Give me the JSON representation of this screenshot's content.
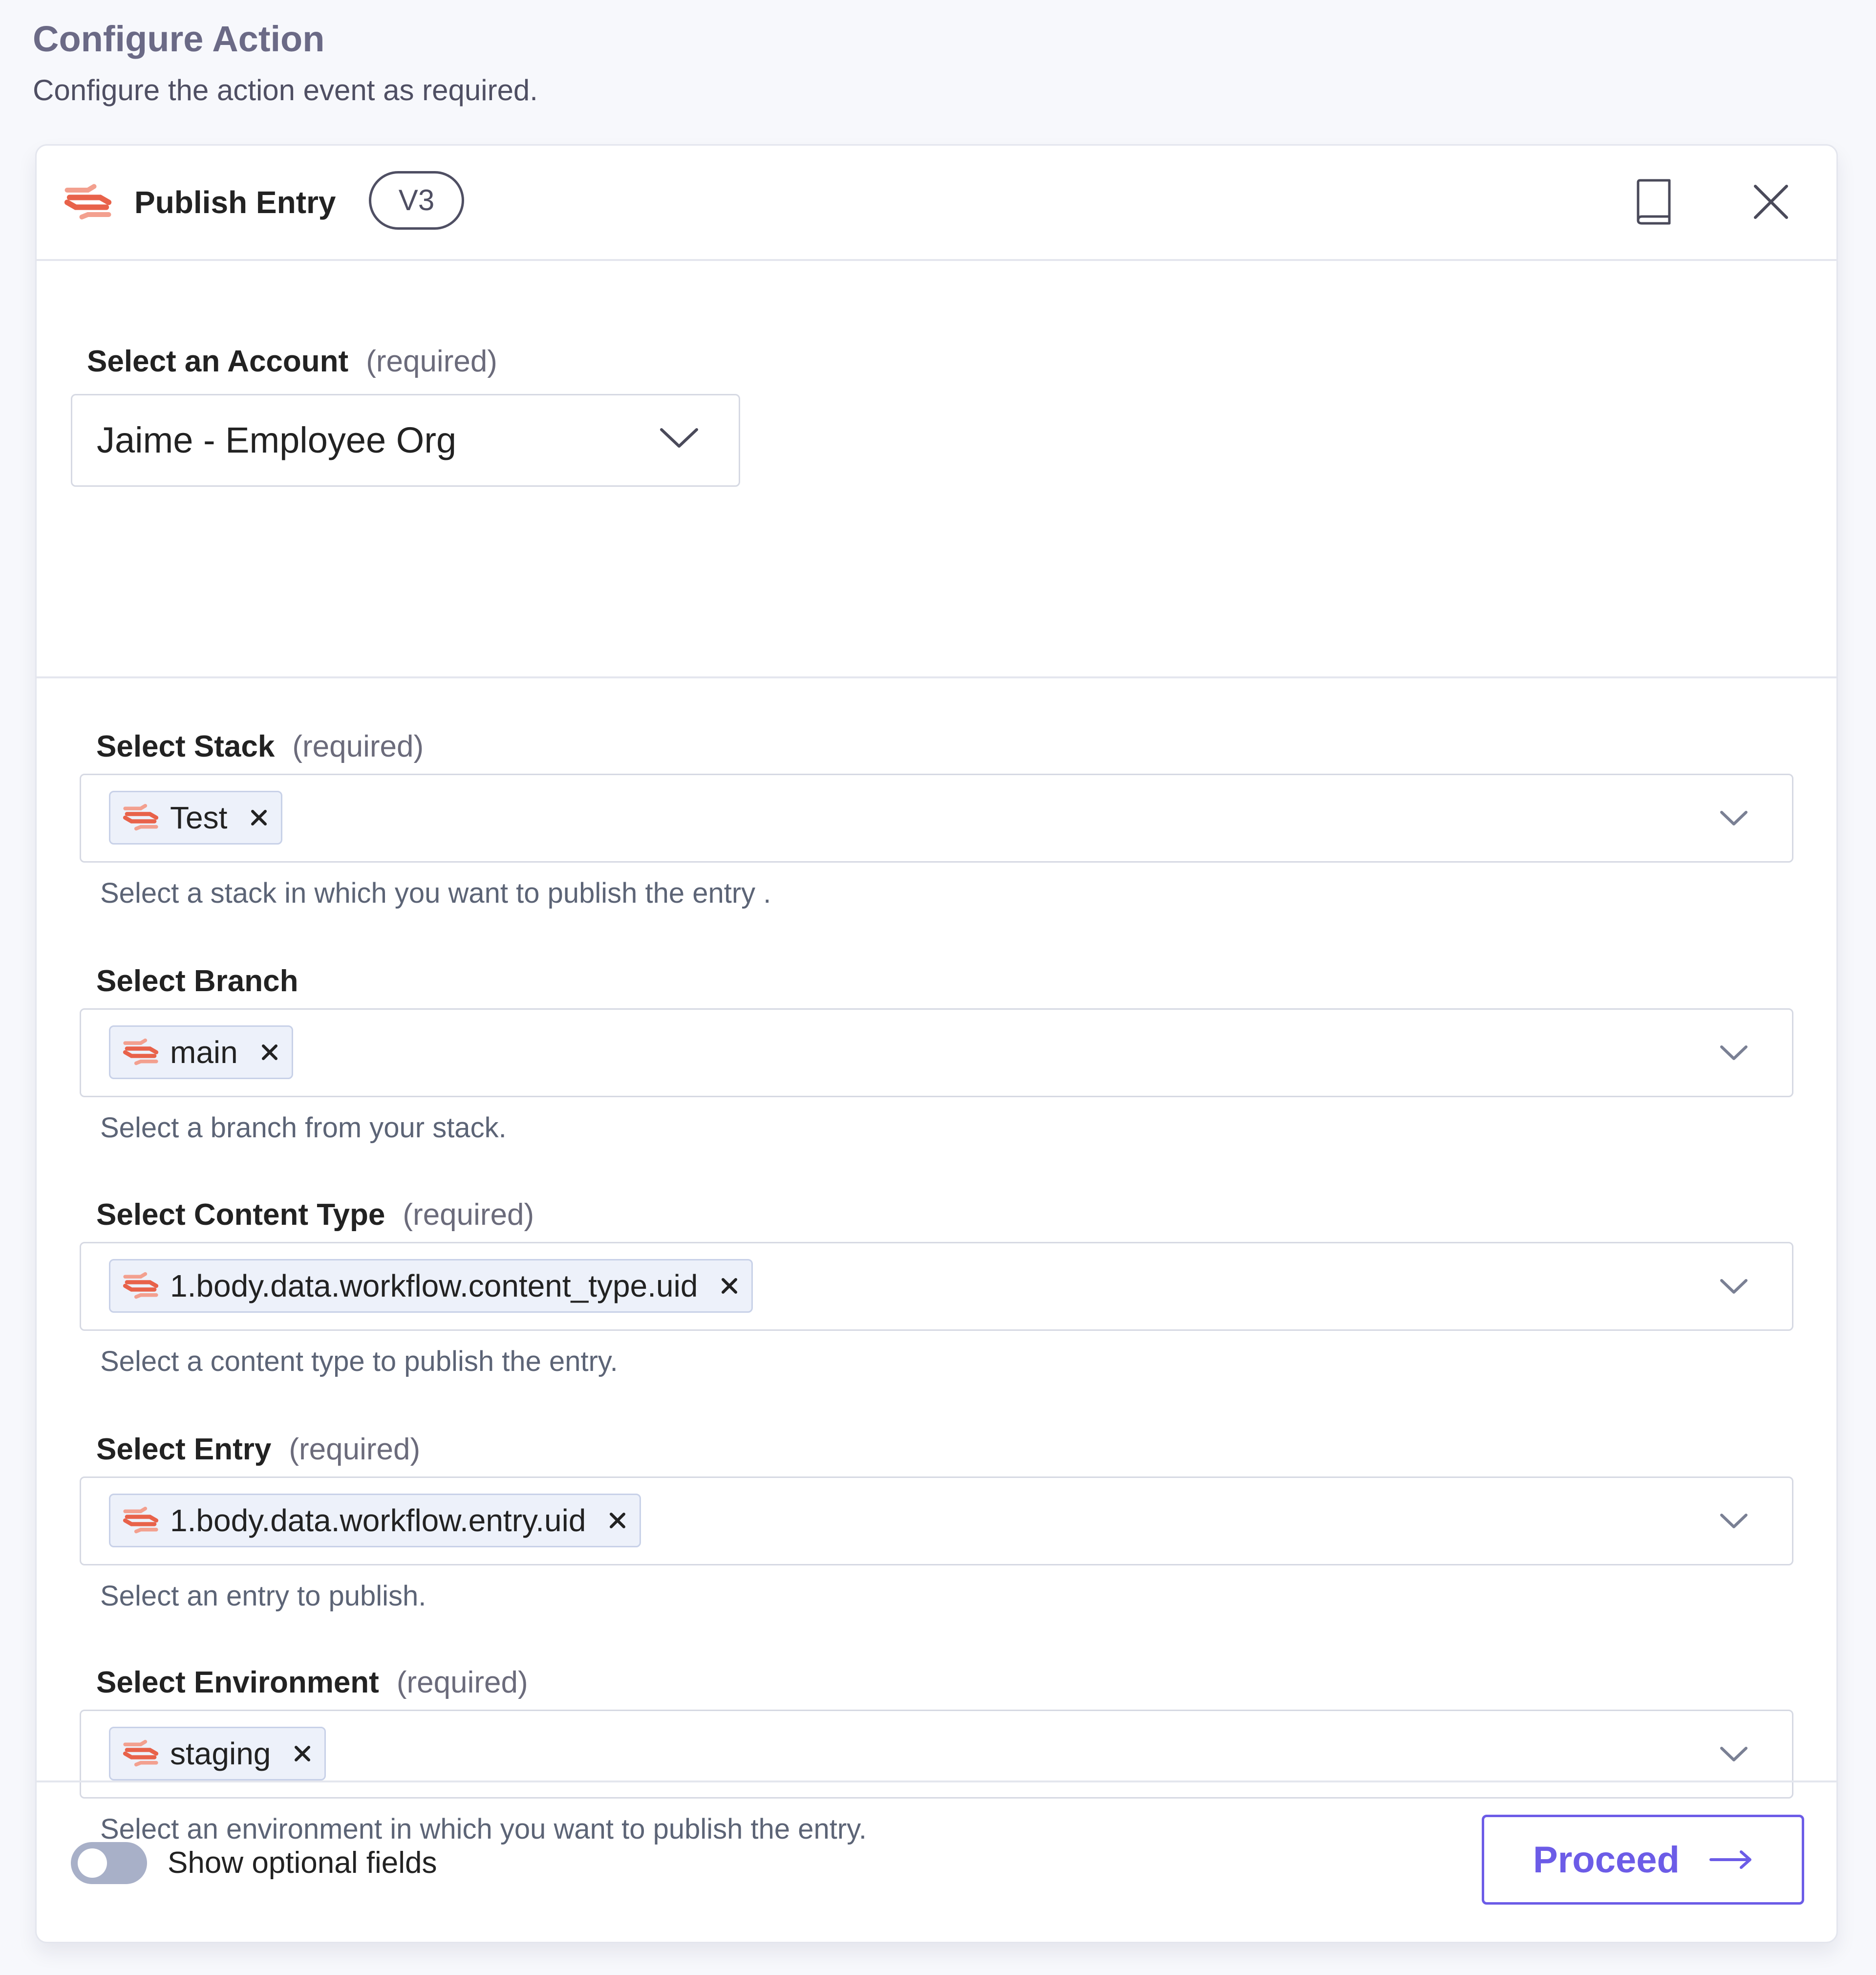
{
  "page": {
    "title": "Configure Action",
    "subtitle": "Configure the action event as required."
  },
  "action": {
    "name": "Publish Entry",
    "version": "V3",
    "icons": {
      "brand": "contentstack-logo-icon",
      "docs": "book-icon",
      "close": "close-icon"
    }
  },
  "account": {
    "label": "Select an Account",
    "required_text": "(required)",
    "value": "Jaime - Employee Org"
  },
  "fields": [
    {
      "label": "Select Stack",
      "required_text": "(required)",
      "tag": "Test",
      "help": "Select a stack in which you want to publish the entry ."
    },
    {
      "label": "Select Branch",
      "required_text": "",
      "tag": "main",
      "help": "Select a branch from your stack."
    },
    {
      "label": "Select Content Type",
      "required_text": "(required)",
      "tag": "1.body.data.workflow.content_type.uid",
      "help": "Select a content type to publish the entry."
    },
    {
      "label": "Select Entry",
      "required_text": "(required)",
      "tag": "1.body.data.workflow.entry.uid",
      "help": "Select an entry to publish."
    },
    {
      "label": "Select Environment",
      "required_text": "(required)",
      "tag": "staging",
      "help": "Select an environment in which you want to publish the entry."
    }
  ],
  "footer": {
    "toggle_label": "Show optional fields",
    "toggle_on": false,
    "proceed_label": "Proceed"
  },
  "colors": {
    "accent": "#6C5CE7",
    "brand": "#E8624A",
    "border": "#D6D9E3",
    "tag_bg": "#EDF1FA",
    "background": "#F7F8FC"
  }
}
